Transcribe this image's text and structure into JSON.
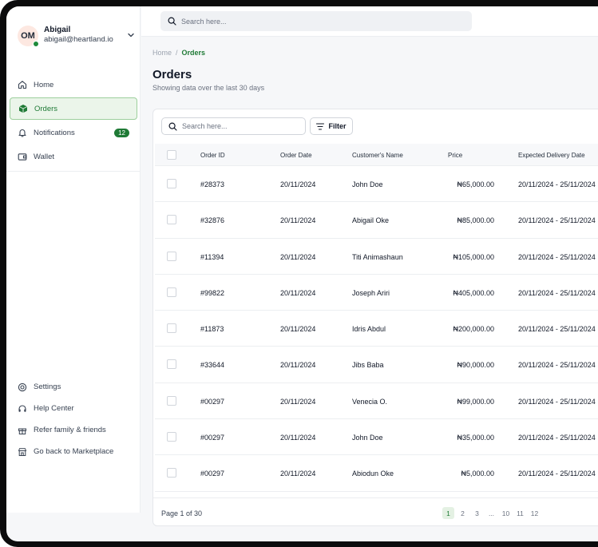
{
  "user": {
    "initials": "OM",
    "name": "Abigail",
    "email": "abigail@heartland.io"
  },
  "sidebar": {
    "items": [
      {
        "label": "Home",
        "icon": "home-icon"
      },
      {
        "label": "Orders",
        "icon": "box-icon",
        "active": true
      },
      {
        "label": "Notifications",
        "icon": "bell-icon",
        "badge": "12"
      },
      {
        "label": "Wallet",
        "icon": "wallet-icon"
      }
    ],
    "bottom_items": [
      {
        "label": "Settings",
        "icon": "settings-icon"
      },
      {
        "label": "Help Center",
        "icon": "headset-icon"
      },
      {
        "label": "Refer family & friends",
        "icon": "gift-icon"
      },
      {
        "label": "Go back to Marketplace",
        "icon": "store-icon"
      }
    ]
  },
  "topbar": {
    "search_placeholder": "Search here..."
  },
  "breadcrumb": {
    "parent": "Home",
    "separator": "/",
    "current": "Orders"
  },
  "page": {
    "title": "Orders",
    "subtitle": "Showing data over the last 30 days"
  },
  "table": {
    "search_placeholder": "Search here...",
    "filter_label": "Filter",
    "columns": [
      "Order ID",
      "Order Date",
      "Customer's Name",
      "Price",
      "Expected Delivery Date"
    ],
    "rows": [
      {
        "id": "#28373",
        "date": "20/11/2024",
        "name": "John Doe",
        "price": "₦65,000.00",
        "delivery": "20/11/2024 - 25/11/2024"
      },
      {
        "id": "#32876",
        "date": "20/11/2024",
        "name": "Abigail Oke",
        "price": "₦85,000.00",
        "delivery": "20/11/2024 - 25/11/2024"
      },
      {
        "id": "#11394",
        "date": "20/11/2024",
        "name": "Titi Animashaun",
        "price": "₦105,000.00",
        "delivery": "20/11/2024 - 25/11/2024"
      },
      {
        "id": "#99822",
        "date": "20/11/2024",
        "name": "Joseph Ariri",
        "price": "₦405,000.00",
        "delivery": "20/11/2024 - 25/11/2024"
      },
      {
        "id": "#11873",
        "date": "20/11/2024",
        "name": "Idris Abdul",
        "price": "₦200,000.00",
        "delivery": "20/11/2024 - 25/11/2024"
      },
      {
        "id": "#33644",
        "date": "20/11/2024",
        "name": "Jibs Baba",
        "price": "₦90,000.00",
        "delivery": "20/11/2024 - 25/11/2024"
      },
      {
        "id": "#00297",
        "date": "20/11/2024",
        "name": "Venecia O.",
        "price": "₦99,000.00",
        "delivery": "20/11/2024 - 25/11/2024"
      },
      {
        "id": "#00297",
        "date": "20/11/2024",
        "name": "John Doe",
        "price": "₦35,000.00",
        "delivery": "20/11/2024 - 25/11/2024"
      },
      {
        "id": "#00297",
        "date": "20/11/2024",
        "name": "Abiodun Oke",
        "price": "₦5,000.00",
        "delivery": "20/11/2024 - 25/11/2024"
      }
    ]
  },
  "pagination": {
    "info": "Page 1 of 30",
    "pages": [
      "1",
      "2",
      "3",
      "...",
      "10",
      "11",
      "12"
    ],
    "current": "1"
  },
  "colors": {
    "accent": "#1f7a36",
    "active_bg": "#ebf5ea",
    "frame": "#0b0b0c"
  }
}
